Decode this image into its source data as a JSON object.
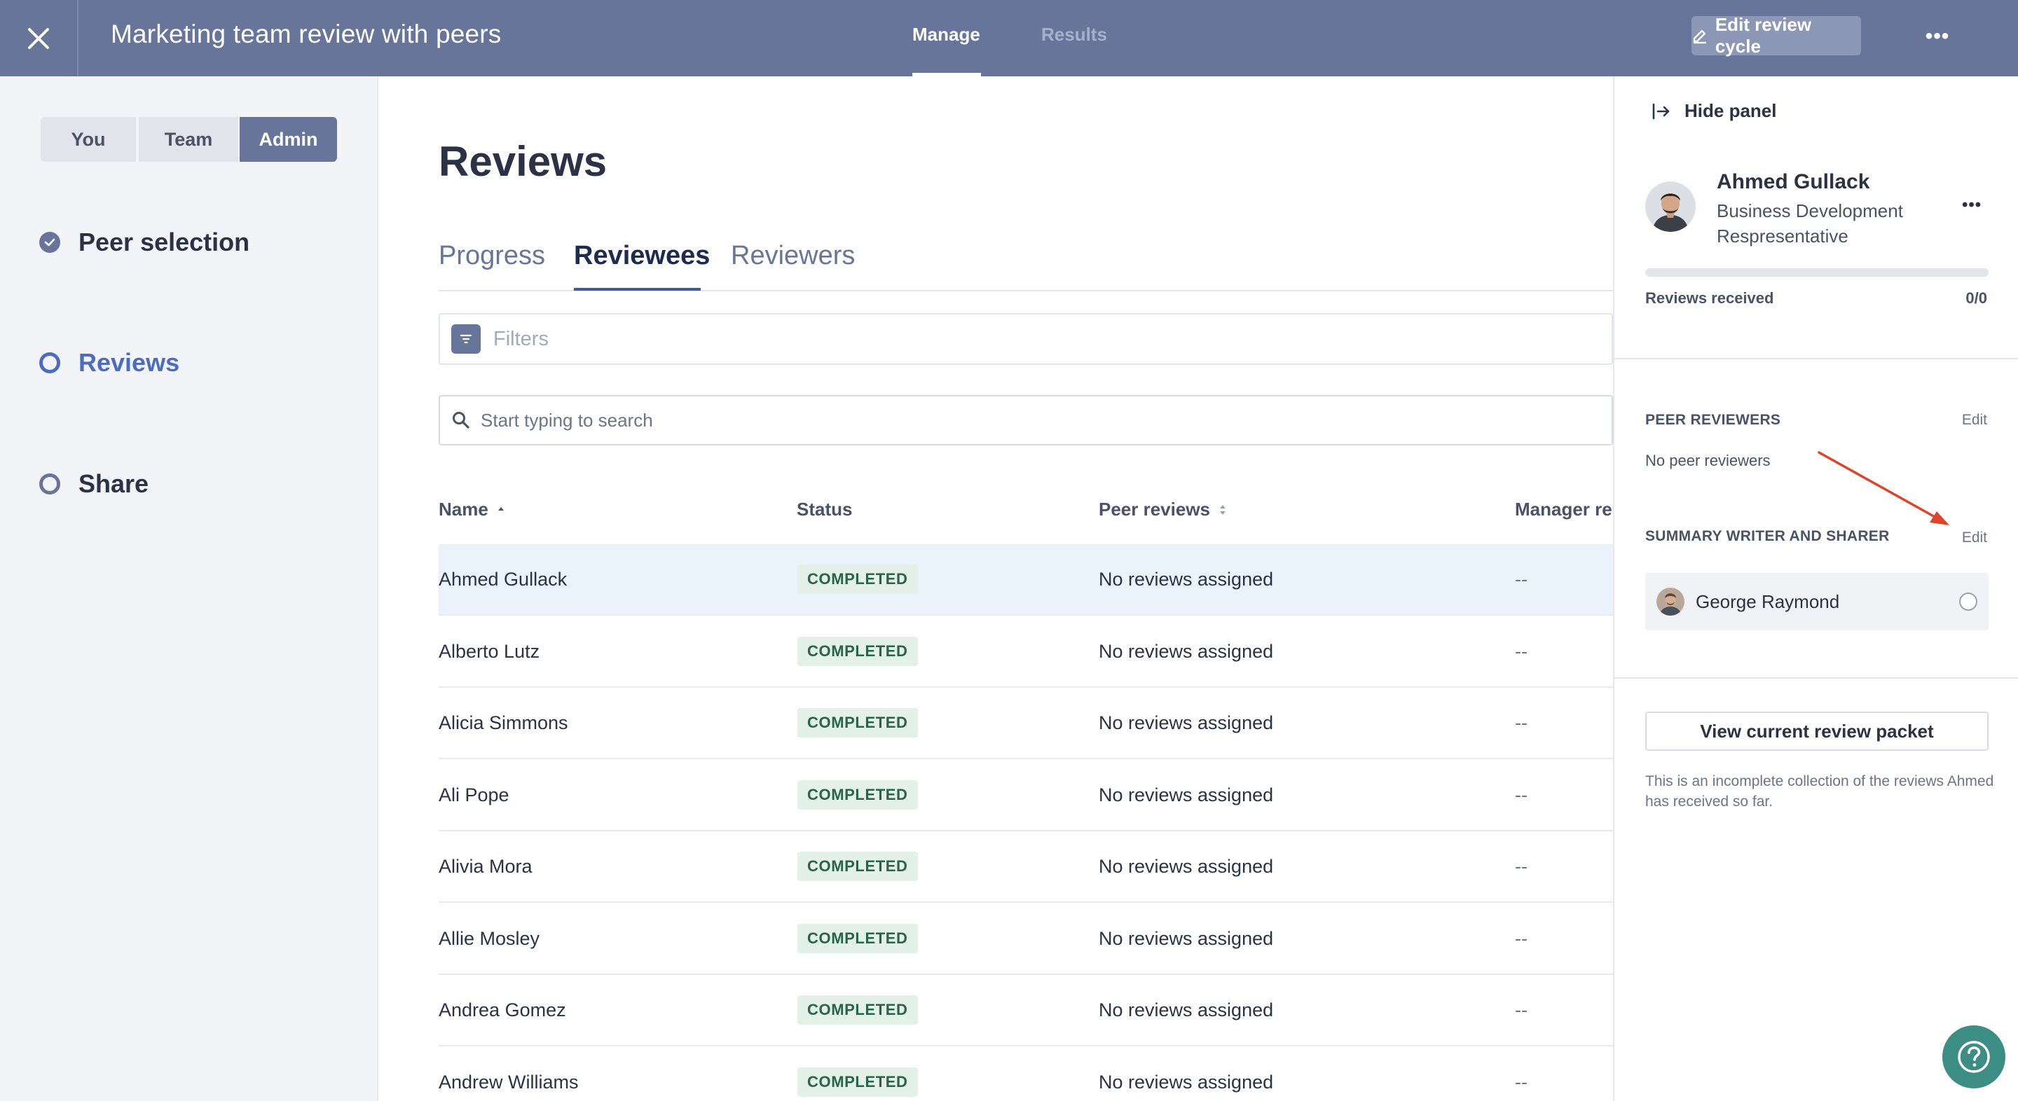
{
  "header": {
    "title": "Marketing team review with peers",
    "tabs": {
      "manage": "Manage",
      "results": "Results"
    },
    "edit_button": "Edit review cycle",
    "more": "•••"
  },
  "sidebar": {
    "segments": {
      "you": "You",
      "team": "Team",
      "admin": "Admin"
    },
    "steps": {
      "peer_selection": "Peer selection",
      "reviews": "Reviews",
      "share": "Share"
    }
  },
  "main": {
    "title": "Reviews",
    "tabs": {
      "progress": "Progress",
      "reviewees": "Reviewees",
      "reviewers": "Reviewers"
    },
    "filters_label": "Filters",
    "search_placeholder": "Start typing to search",
    "columns": {
      "name": "Name",
      "status": "Status",
      "peer_reviews": "Peer reviews",
      "manager": "Manager re"
    },
    "rows": [
      {
        "name": "Ahmed Gullack",
        "status": "COMPLETED",
        "peer": "No reviews assigned",
        "manager": "--"
      },
      {
        "name": "Alberto Lutz",
        "status": "COMPLETED",
        "peer": "No reviews assigned",
        "manager": "--"
      },
      {
        "name": "Alicia Simmons",
        "status": "COMPLETED",
        "peer": "No reviews assigned",
        "manager": "--"
      },
      {
        "name": "Ali Pope",
        "status": "COMPLETED",
        "peer": "No reviews assigned",
        "manager": "--"
      },
      {
        "name": "Alivia Mora",
        "status": "COMPLETED",
        "peer": "No reviews assigned",
        "manager": "--"
      },
      {
        "name": "Allie Mosley",
        "status": "COMPLETED",
        "peer": "No reviews assigned",
        "manager": "--"
      },
      {
        "name": "Andrea Gomez",
        "status": "COMPLETED",
        "peer": "No reviews assigned",
        "manager": "--"
      },
      {
        "name": "Andrew Williams",
        "status": "COMPLETED",
        "peer": "No reviews assigned",
        "manager": "--"
      }
    ]
  },
  "panel": {
    "hide_label": "Hide panel",
    "person": {
      "name": "Ahmed Gullack",
      "role": "Business Development Respresentative"
    },
    "more": "•••",
    "reviews_received_label": "Reviews received",
    "reviews_received_value": "0/0",
    "reviews_received_fraction": 0,
    "peer_reviewers_label": "PEER REVIEWERS",
    "peer_reviewers_edit": "Edit",
    "peer_reviewers_empty": "No peer reviewers",
    "summary_label": "SUMMARY WRITER AND SHARER",
    "summary_edit": "Edit",
    "summary_person": "George Raymond",
    "packet_button": "View current review packet",
    "packet_note": "This is an incomplete collection of the reviews Ahmed has received so far."
  },
  "colors": {
    "topbar": "#67759a",
    "active_step": "#4b6cc1",
    "badge_bg": "#e4f1e9",
    "badge_text": "#28634a",
    "help": "#3c8d84",
    "annotation_arrow": "#e0432b"
  },
  "icons": [
    "close-icon",
    "pencil-icon",
    "more-icon",
    "check-circle-icon",
    "filter-icon",
    "search-icon",
    "sort-up-icon",
    "sort-both-icon",
    "hide-panel-icon",
    "help-icon"
  ]
}
